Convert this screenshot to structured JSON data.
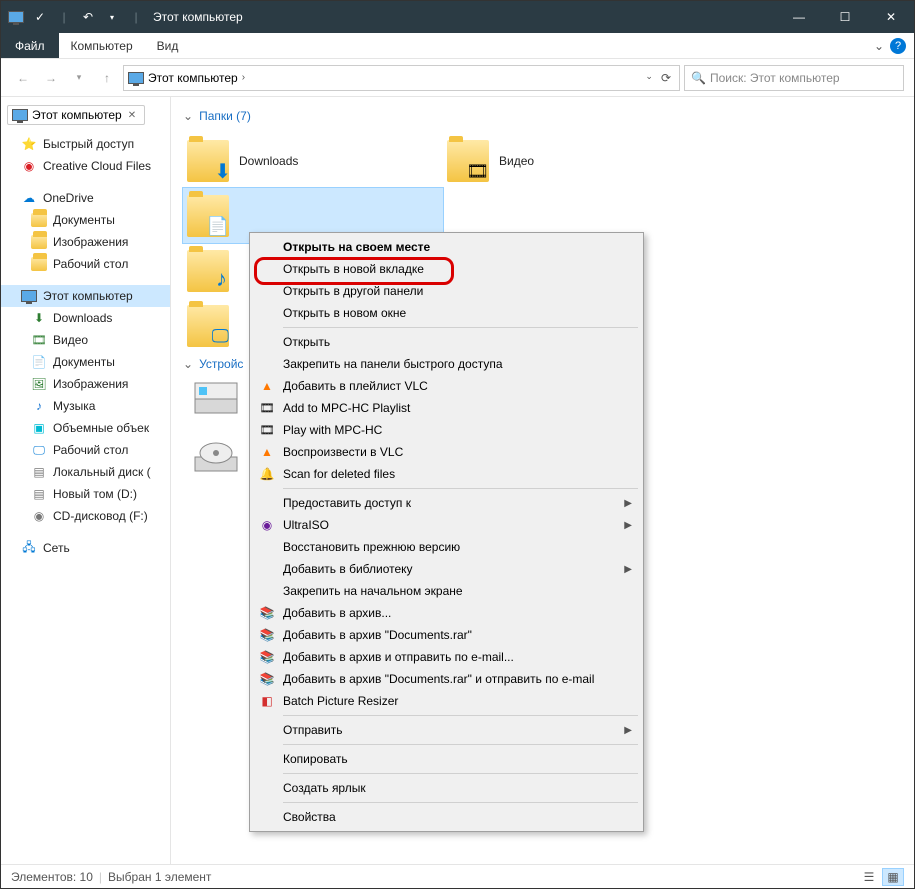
{
  "title": "Этот компьютер",
  "menu": {
    "file": "Файл",
    "computer": "Компьютер",
    "view": "Вид"
  },
  "breadcrumb": "Этот компьютер",
  "search_placeholder": "Поиск: Этот компьютер",
  "tab": "Этот компьютер",
  "sidebar": {
    "quick_access": "Быстрый доступ",
    "ccf": "Creative Cloud Files",
    "onedrive": "OneDrive",
    "od_docs": "Документы",
    "od_images": "Изображения",
    "od_desktop": "Рабочий стол",
    "this_pc": "Этот компьютер",
    "downloads": "Downloads",
    "video": "Видео",
    "documents": "Документы",
    "images": "Изображения",
    "music": "Музыка",
    "objects3d": "Объемные объек",
    "desktop": "Рабочий стол",
    "local_disk": "Локальный диск (",
    "new_volume": "Новый том (D:)",
    "cd_drive": "CD-дисковод (F:)",
    "network": "Сеть"
  },
  "groups": {
    "folders": "Папки (7)",
    "devices": "Устройс"
  },
  "folders": {
    "downloads": "Downloads",
    "video": "Видео"
  },
  "context_menu": {
    "open_in_place": "Открыть на своем месте",
    "open_new_tab": "Открыть в новой вкладке",
    "open_other_panel": "Открыть в другой панели",
    "open_new_window": "Открыть в новом окне",
    "open": "Открыть",
    "pin_quick_access": "Закрепить на панели быстрого доступа",
    "add_vlc_playlist": "Добавить в плейлист VLC",
    "add_mpc_playlist": "Add to MPC-HC Playlist",
    "play_mpc": "Play with MPC-HC",
    "play_vlc": "Воспроизвести в VLC",
    "scan_deleted": "Scan for deleted files",
    "grant_access": "Предоставить доступ к",
    "ultraiso": "UltraISO",
    "restore_prev": "Восстановить прежнюю версию",
    "add_library": "Добавить в библиотеку",
    "pin_start": "Закрепить на начальном экране",
    "add_archive": "Добавить в архив...",
    "add_archive_docs": "Добавить в архив \"Documents.rar\"",
    "add_archive_email": "Добавить в архив и отправить по e-mail...",
    "add_archive_docs_email": "Добавить в архив \"Documents.rar\" и отправить по e-mail",
    "batch_resizer": "Batch Picture Resizer",
    "send_to": "Отправить",
    "copy": "Копировать",
    "create_shortcut": "Создать ярлык",
    "properties": "Свойства"
  },
  "status": {
    "elements": "Элементов: 10",
    "selected": "Выбран 1 элемент"
  }
}
